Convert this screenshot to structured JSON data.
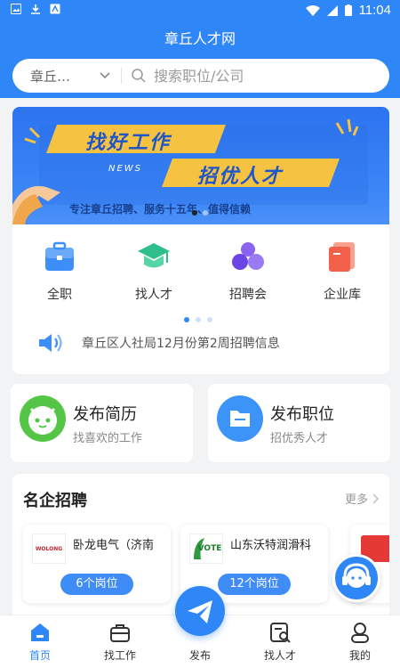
{
  "status_bar": {
    "time": "11:04"
  },
  "header": {
    "title": "章丘人才网"
  },
  "search": {
    "city": "章丘…",
    "placeholder": "搜索职位/公司"
  },
  "banner": {
    "headline_1": "找好工作",
    "headline_2": "招优人才",
    "tag": "NEWS",
    "slogan": "专注章丘招聘、服务十五年、值得信赖"
  },
  "categories": [
    {
      "label": "全职",
      "icon": "briefcase-icon"
    },
    {
      "label": "找人才",
      "icon": "graduation-cap-icon"
    },
    {
      "label": "招聘会",
      "icon": "people-group-icon"
    },
    {
      "label": "企业库",
      "icon": "company-library-icon"
    }
  ],
  "notice": {
    "text": "章丘区人社局12月份第2周招聘信息"
  },
  "actions": {
    "resume": {
      "title": "发布简历",
      "subtitle": "找喜欢的工作"
    },
    "job": {
      "title": "发布职位",
      "subtitle": "招优秀人才"
    }
  },
  "famous": {
    "title": "名企招聘",
    "more": "更多",
    "companies": [
      {
        "name": "卧龙电气（济南",
        "jobs": "6个岗位",
        "logo_text": "WOLONG"
      },
      {
        "name": "山东沃特润滑科",
        "jobs": "12个岗位",
        "logo_text": "VOTE"
      }
    ]
  },
  "tabs": [
    {
      "label": "首页",
      "icon": "home-icon"
    },
    {
      "label": "找工作",
      "icon": "briefcase-icon"
    },
    {
      "label": "发布",
      "icon": "paper-plane-icon"
    },
    {
      "label": "找人才",
      "icon": "find-talent-icon"
    },
    {
      "label": "我的",
      "icon": "user-icon"
    }
  ],
  "colors": {
    "primary": "#2f86f6",
    "banner_yellow": "#f5c242"
  }
}
